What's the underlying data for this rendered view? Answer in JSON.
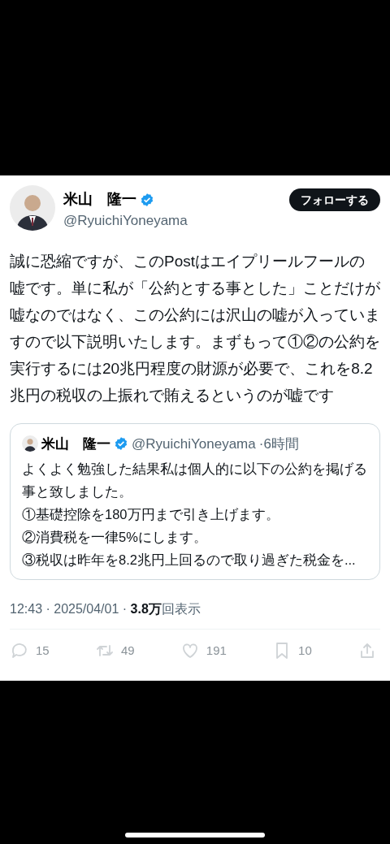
{
  "post": {
    "author": {
      "name": "米山　隆一",
      "handle": "@RyuichiYoneyama",
      "verified": true
    },
    "follow_button": "フォローする",
    "text": "誠に恐縮ですが、このPostはエイプリールフールの嘘です。単に私が「公約とする事とした」ことだけが嘘なのではなく、この公約には沢山の嘘が入っていますので以下説明いたします。まずもって①②の公約を実行するには20兆円程度の財源が必要で、これを8.2兆円の税収の上振れで賄えるというのが嘘です",
    "quote": {
      "name": "米山　隆一",
      "verified": true,
      "handle": "@RyuichiYoneyama",
      "time": "·6時間",
      "lines": [
        "よくよく勉強した結果私は個人的に以下の公約を掲げる事と致しました。",
        "①基礎控除を180万円まで引き上げます。",
        "②消費税を一律5%にします。",
        "③税収は昨年を8.2兆円上回るので取り過ぎた税金を..."
      ]
    },
    "meta": "12:43 · 2025/04/01 · **3.8万**回表示",
    "actions": [
      {
        "kind": "reply",
        "count": "15"
      },
      {
        "kind": "repost",
        "count": "49"
      },
      {
        "kind": "like",
        "count": "191"
      },
      {
        "kind": "bookmark",
        "count": "10"
      },
      {
        "kind": "share"
      }
    ]
  }
}
